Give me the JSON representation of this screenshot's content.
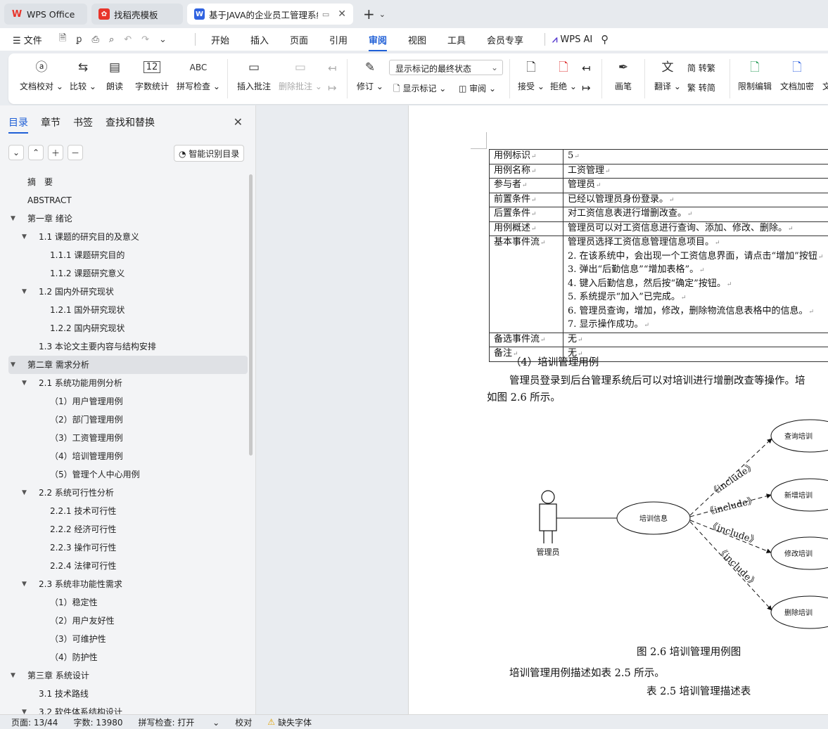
{
  "tabs": [
    {
      "label": "WPS Office",
      "icon": "wps-logo-icon"
    },
    {
      "label": "找稻壳模板",
      "icon": "docer-icon"
    },
    {
      "label": "基于JAVA的企业员工管理系统",
      "icon": "writer-doc-icon",
      "active": true
    }
  ],
  "menu": {
    "file": "文件",
    "items": [
      "开始",
      "插入",
      "页面",
      "引用",
      "审阅",
      "视图",
      "工具",
      "会员专享"
    ],
    "active": "审阅",
    "wps_ai": "WPS AI"
  },
  "ribbon": {
    "doc_check": "文档校对",
    "compare": "比较",
    "read_aloud": "朗读",
    "word_count": "字数统计",
    "spell_check": "拼写检查",
    "insert_comment": "插入批注",
    "delete_comment": "删除批注",
    "revise": "修订",
    "display_state": "显示标记的最终状态",
    "show_markup": "显示标记",
    "review": "审阅",
    "accept": "接受",
    "reject": "拒绝",
    "pen": "画笔",
    "translate": "翻译",
    "to_traditional": "转繁",
    "to_simplified": "转简",
    "restrict_edit": "限制编辑",
    "doc_encrypt": "文档加密",
    "more": "文",
    "word_count_icon_text": "12",
    "spell_icon_text": "ABC"
  },
  "nav": {
    "tabs": [
      "目录",
      "章节",
      "书签",
      "查找和替换"
    ],
    "active_tab": "目录",
    "smart_btn": "智能识别目录",
    "toc": [
      {
        "label": "摘　要",
        "level": 0
      },
      {
        "label": "ABSTRACT",
        "level": 0
      },
      {
        "label": "第一章  绪论",
        "level": 0,
        "toggle": true
      },
      {
        "label": "1.1    课题的研究目的及意义",
        "level": 1,
        "toggle": true
      },
      {
        "label": "1.1.1    课题研究目的",
        "level": 2
      },
      {
        "label": "1.1.2  课题研究意义",
        "level": 2
      },
      {
        "label": "1.2  国内外研究现状",
        "level": 1,
        "toggle": true
      },
      {
        "label": "1.2.1  国外研究现状",
        "level": 2
      },
      {
        "label": "1.2.2  国内研究现状",
        "level": 2
      },
      {
        "label": "1.3  本论文主要内容与结构安排",
        "level": 1
      },
      {
        "label": "第二章  需求分析",
        "level": 0,
        "toggle": true,
        "selected": true
      },
      {
        "label": "2.1  系统功能用例分析",
        "level": 1,
        "toggle": true
      },
      {
        "label": "（1）用户管理用例",
        "level": 2
      },
      {
        "label": "（2）部门管理用例",
        "level": 2
      },
      {
        "label": "（3）工资管理用例",
        "level": 2
      },
      {
        "label": "（4）培训管理用例",
        "level": 2
      },
      {
        "label": "（5）管理个人中心用例",
        "level": 2
      },
      {
        "label": "2.2  系统可行性分析",
        "level": 1,
        "toggle": true
      },
      {
        "label": "2.2.1  技术可行性",
        "level": 2
      },
      {
        "label": "2.2.2  经济可行性",
        "level": 2
      },
      {
        "label": "2.2.3  操作可行性",
        "level": 2
      },
      {
        "label": "2.2.4  法律可行性",
        "level": 2
      },
      {
        "label": "2.3  系统非功能性需求",
        "level": 1,
        "toggle": true
      },
      {
        "label": "（1）稳定性",
        "level": 2
      },
      {
        "label": "（2）用户友好性",
        "level": 2
      },
      {
        "label": "（3）可维护性",
        "level": 2
      },
      {
        "label": "（4）防护性",
        "level": 2
      },
      {
        "label": "第三章  系统设计",
        "level": 0,
        "toggle": true
      },
      {
        "label": "3.1  技术路线",
        "level": 1
      },
      {
        "label": "3.2  软件体系结构设计",
        "level": 1,
        "toggle": true
      }
    ]
  },
  "doc": {
    "table": [
      {
        "k": "用例标识",
        "v": [
          "5"
        ]
      },
      {
        "k": "用例名称",
        "v": [
          "工资管理"
        ]
      },
      {
        "k": "参与者",
        "v": [
          "管理员"
        ]
      },
      {
        "k": "前置条件",
        "v": [
          "已经以管理员身份登录。"
        ]
      },
      {
        "k": "后置条件",
        "v": [
          "对工资信息表进行增删改查。"
        ]
      },
      {
        "k": "用例概述",
        "v": [
          "管理员可以对工资信息进行查询、添加、修改、删除。"
        ]
      },
      {
        "k": "基本事件流",
        "v": [
          "管理员选择工资信息管理信息项目。",
          "2. 在该系统中，会出现一个工资信息界面，请点击“增加”按钮",
          "3. 弹出“后勤信息”“增加表格”。",
          "4. 键入后勤信息，然后按“确定”按钮。",
          "5. 系统提示“加入”已完成。",
          "6. 管理员查询，增加，修改，删除物流信息表格中的信息。",
          "7. 显示操作成功。"
        ]
      },
      {
        "k": "备选事件流",
        "v": [
          "无"
        ]
      },
      {
        "k": "备注",
        "v": [
          "无"
        ]
      }
    ],
    "heading": "（4）培训管理用例",
    "para1": "管理员登录到后台管理系统后可以对培训进行增删改查等操作。培",
    "para2": "如图 2.6 所示。",
    "diagram": {
      "actor": "管理员",
      "center": "培训信息",
      "targets": [
        "查询培训",
        "新增培训",
        "修改培训",
        "删除培训"
      ],
      "relation": "《include》"
    },
    "fig_caption": "图 2.6 培训管理用例图",
    "para3": "培训管理用例描述如表 2.5 所示。",
    "table_caption": "表 2.5  培训管理描述表"
  },
  "status": {
    "page": "页面: 13/44",
    "words": "字数: 13980",
    "spell": "拼写检查: 打开",
    "proof": "校对",
    "missing_font": "缺失字体"
  }
}
